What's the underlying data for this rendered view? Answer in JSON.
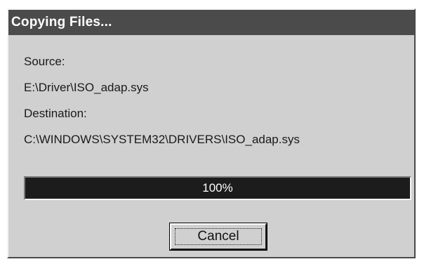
{
  "window": {
    "title": "Copying Files..."
  },
  "source": {
    "label": "Source:",
    "path": "E:\\Driver\\ISO_adap.sys"
  },
  "destination": {
    "label": "Destination:",
    "path": "C:\\WINDOWS\\SYSTEM32\\DRIVERS\\ISO_adap.sys"
  },
  "progress": {
    "percent": 100,
    "text": "100%"
  },
  "buttons": {
    "cancel_label": "Cancel"
  }
}
